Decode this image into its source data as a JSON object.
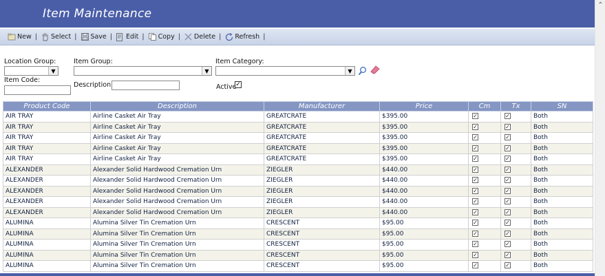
{
  "header": {
    "title": "Item Maintenance"
  },
  "toolbar": {
    "new": "New",
    "select": "Select",
    "save": "Save",
    "edit": "Edit",
    "copy": "Copy",
    "delete": "Delete",
    "refresh": "Refresh",
    "separator": "|"
  },
  "filters": {
    "location_group_label": "Location Group:",
    "item_group_label": "Item Group:",
    "item_category_label": "Item Category:",
    "item_code_label": "Item Code:",
    "description_label": "Description:",
    "active_label": "Active",
    "active_checked": true
  },
  "table": {
    "headers": [
      "Product Code",
      "Description",
      "Manufacturer",
      "Price",
      "Cm",
      "Tx",
      "SN"
    ],
    "rows": [
      {
        "code": "AIR TRAY",
        "description": "Airline Casket Air Tray",
        "manufacturer": "GREATCRATE",
        "price": "$395.00",
        "cm": true,
        "tx": true,
        "sn": "Both"
      },
      {
        "code": "AIR TRAY",
        "description": "Airline Casket Air Tray",
        "manufacturer": "GREATCRATE",
        "price": "$395.00",
        "cm": true,
        "tx": true,
        "sn": "Both"
      },
      {
        "code": "AIR TRAY",
        "description": "Airline Casket Air Tray",
        "manufacturer": "GREATCRATE",
        "price": "$395.00",
        "cm": true,
        "tx": true,
        "sn": "Both"
      },
      {
        "code": "AIR TRAY",
        "description": "Airline Casket Air Tray",
        "manufacturer": "GREATCRATE",
        "price": "$395.00",
        "cm": true,
        "tx": true,
        "sn": "Both"
      },
      {
        "code": "AIR TRAY",
        "description": "Airline Casket Air Tray",
        "manufacturer": "GREATCRATE",
        "price": "$395.00",
        "cm": true,
        "tx": true,
        "sn": "Both"
      },
      {
        "code": "ALEXANDER",
        "description": "Alexander Solid Hardwood Cremation Urn",
        "manufacturer": "ZIEGLER",
        "price": "$440.00",
        "cm": true,
        "tx": true,
        "sn": "Both"
      },
      {
        "code": "ALEXANDER",
        "description": "Alexander Solid Hardwood Cremation Urn",
        "manufacturer": "ZIEGLER",
        "price": "$440.00",
        "cm": true,
        "tx": true,
        "sn": "Both"
      },
      {
        "code": "ALEXANDER",
        "description": "Alexander Solid Hardwood Cremation Urn",
        "manufacturer": "ZIEGLER",
        "price": "$440.00",
        "cm": true,
        "tx": true,
        "sn": "Both"
      },
      {
        "code": "ALEXANDER",
        "description": "Alexander Solid Hardwood Cremation Urn",
        "manufacturer": "ZIEGLER",
        "price": "$440.00",
        "cm": true,
        "tx": true,
        "sn": "Both"
      },
      {
        "code": "ALEXANDER",
        "description": "Alexander Solid Hardwood Cremation Urn",
        "manufacturer": "ZIEGLER",
        "price": "$440.00",
        "cm": true,
        "tx": true,
        "sn": "Both"
      },
      {
        "code": "ALUMINA",
        "description": "Alumina Silver Tin Cremation Urn",
        "manufacturer": "CRESCENT",
        "price": "$95.00",
        "cm": true,
        "tx": true,
        "sn": "Both"
      },
      {
        "code": "ALUMINA",
        "description": "Alumina Silver Tin Cremation Urn",
        "manufacturer": "CRESCENT",
        "price": "$95.00",
        "cm": true,
        "tx": true,
        "sn": "Both"
      },
      {
        "code": "ALUMINA",
        "description": "Alumina Silver Tin Cremation Urn",
        "manufacturer": "CRESCENT",
        "price": "$95.00",
        "cm": true,
        "tx": true,
        "sn": "Both"
      },
      {
        "code": "ALUMINA",
        "description": "Alumina Silver Tin Cremation Urn",
        "manufacturer": "CRESCENT",
        "price": "$95.00",
        "cm": true,
        "tx": true,
        "sn": "Both"
      },
      {
        "code": "ALUMINA",
        "description": "Alumina Silver Tin Cremation Urn",
        "manufacturer": "CRESCENT",
        "price": "$95.00",
        "cm": true,
        "tx": true,
        "sn": "Both"
      }
    ]
  },
  "colors": {
    "header_blue": "#4a5ea8",
    "grid_header": "#8596c3",
    "alt_row": "#f4f3ea"
  },
  "icons": {
    "search": "magnifier-icon",
    "clear": "eraser-icon"
  }
}
